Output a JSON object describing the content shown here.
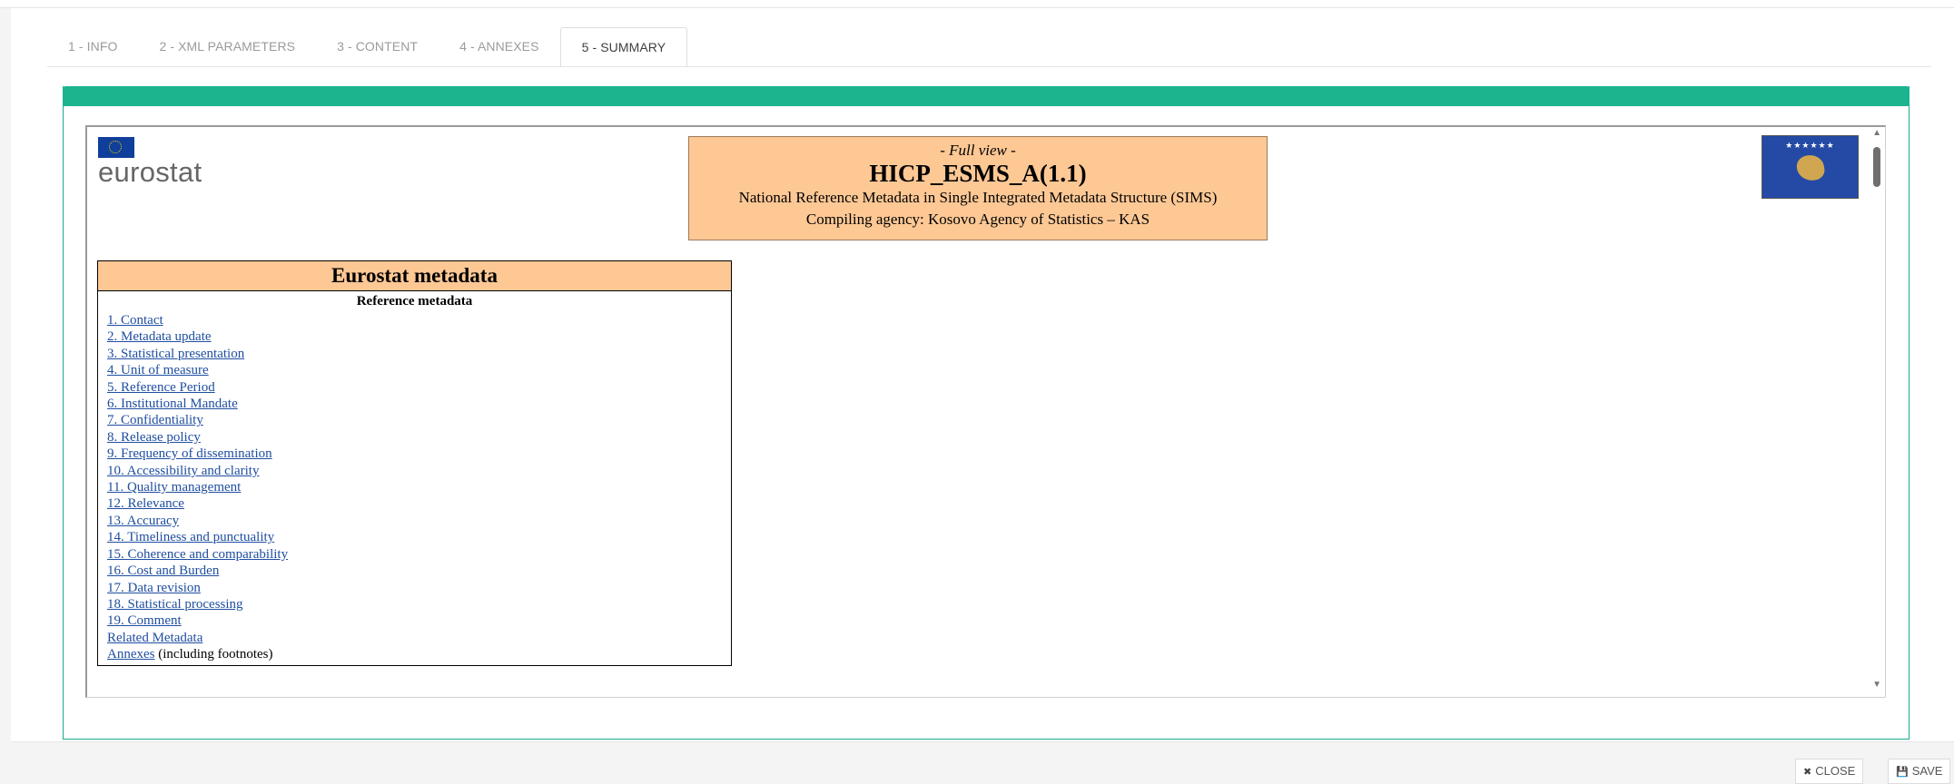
{
  "tabs": [
    {
      "label": "1 - INFO"
    },
    {
      "label": "2 - XML PARAMETERS"
    },
    {
      "label": "3 - CONTENT"
    },
    {
      "label": "4 - ANNEXES"
    },
    {
      "label": "5 - SUMMARY",
      "active": true
    }
  ],
  "logo": {
    "text": "eurostat"
  },
  "header": {
    "view": "- Full view -",
    "title": "HICP_ESMS_A(1.1)",
    "subtitle": "National Reference Metadata in Single Integrated Metadata Structure (SIMS)",
    "agency": "Compiling agency: Kosovo Agency of Statistics – KAS"
  },
  "flag": {
    "stars": "★★★★★★"
  },
  "metadata": {
    "title": "Eurostat metadata",
    "subtitle": "Reference metadata",
    "links": [
      "1. Contact",
      "2. Metadata update",
      "3. Statistical presentation",
      "4. Unit of measure",
      "5. Reference Period",
      "6. Institutional Mandate",
      "7. Confidentiality",
      "8. Release policy",
      "9. Frequency of dissemination",
      "10. Accessibility and clarity",
      "11. Quality management",
      "12. Relevance",
      "13. Accuracy",
      "14. Timeliness and punctuality",
      "15. Coherence and comparability",
      "16. Cost and Burden",
      "17. Data revision",
      "18. Statistical processing",
      "19. Comment",
      "Related Metadata"
    ],
    "annexes_link": "Annexes",
    "annexes_note": " (including footnotes)"
  },
  "scroll": {
    "up": "▲",
    "down": "▼"
  },
  "buttons": {
    "close_icon": "✖",
    "close": "CLOSE",
    "save_icon": "💾",
    "save": "SAVE"
  },
  "colors": {
    "accent": "#1cb38f",
    "header_bg": "#fec895",
    "link": "#1f4ea0"
  }
}
